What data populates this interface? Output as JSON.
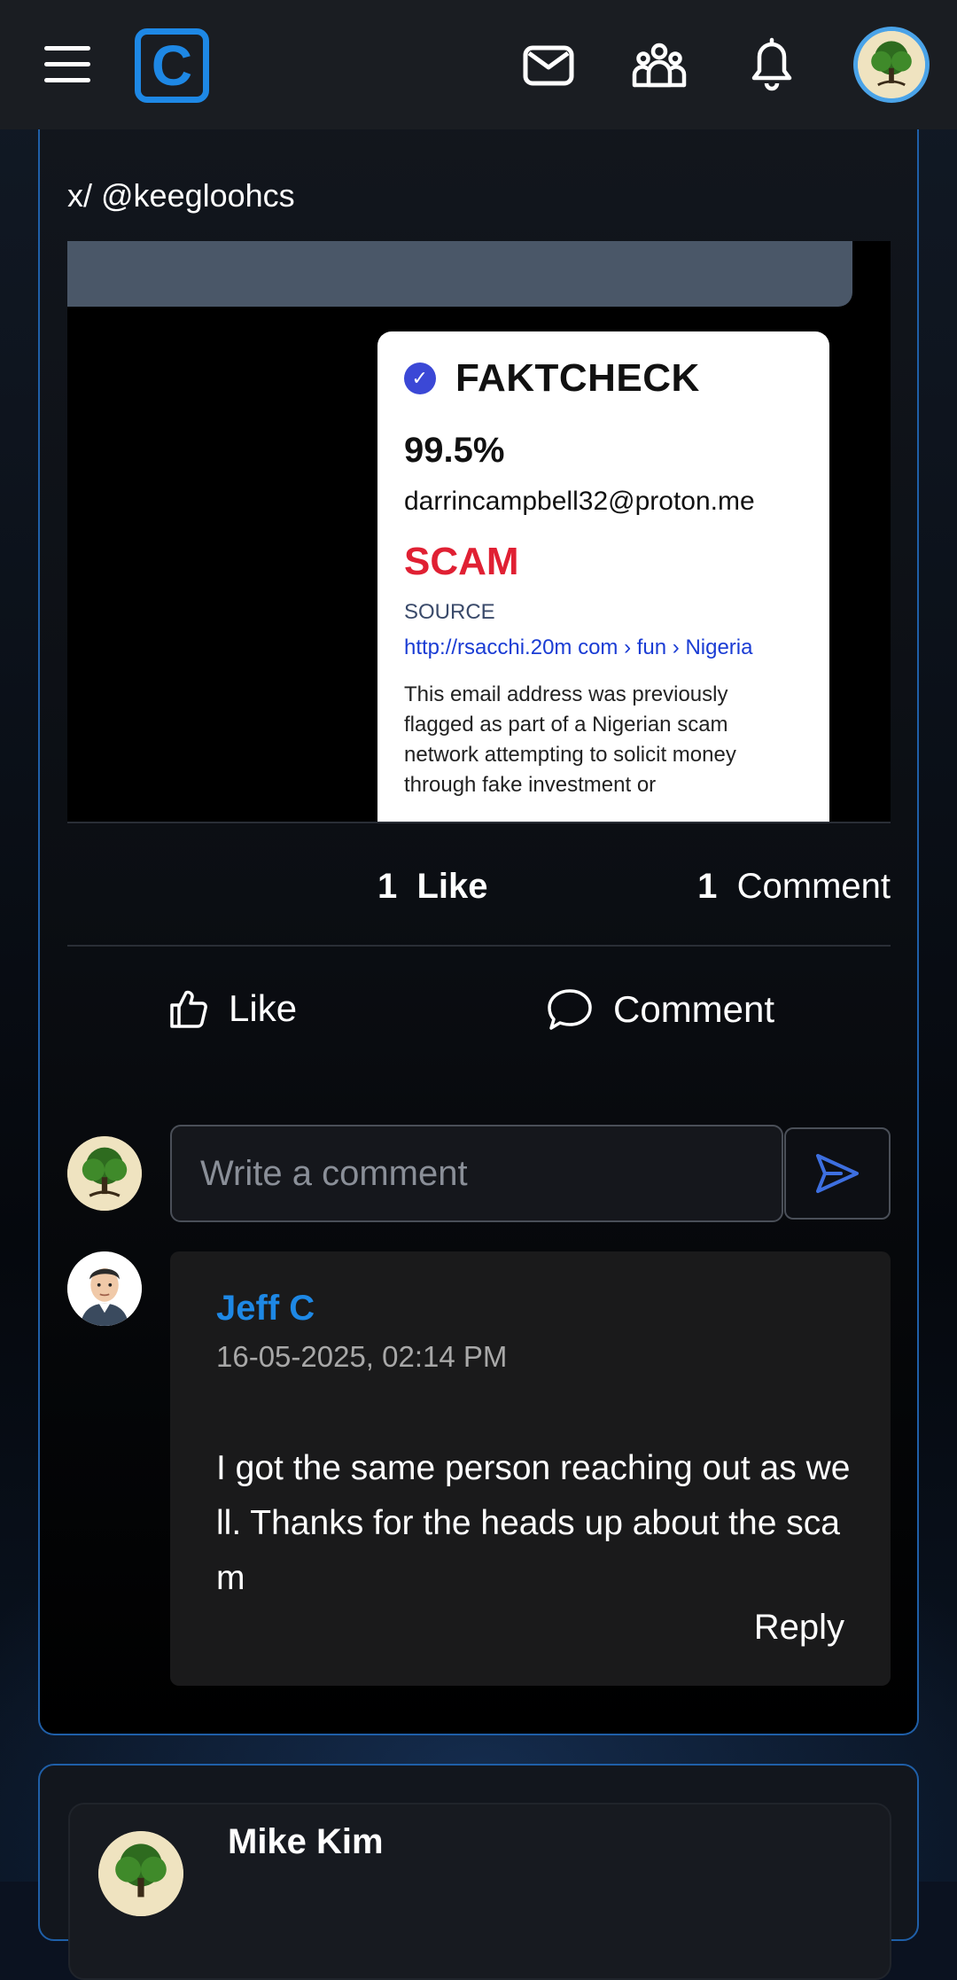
{
  "header": {
    "menu_icon": "hamburger-menu-icon",
    "logo_letter": "C",
    "icons": [
      "mail-icon",
      "groups-icon",
      "bell-icon"
    ],
    "accent_color": "#1e88e5"
  },
  "post": {
    "handle": "x/ @keegloohcs",
    "image": {
      "title": "FAKTCHECK",
      "percent": "99.5%",
      "email": "darrincampbell32@proton.me",
      "verdict": "SCAM",
      "source_label": "SOURCE",
      "source_url": "http://rsacchi.20m com › fun › Nigeria",
      "description": "This email address was previously flagged as part of a Nigerian scam network attempting to solicit money through fake investment or"
    },
    "stats": {
      "likes_count": "1",
      "likes_label": "Like",
      "comments_count": "1",
      "comments_label": "Comment"
    },
    "actions": {
      "like_label": "Like",
      "comment_label": "Comment"
    },
    "comment_input": {
      "placeholder": "Write a comment"
    },
    "comments": [
      {
        "author": "Jeff C",
        "timestamp": "16-05-2025, 02:14 PM",
        "text": "I got the same person reaching out as well. Thanks for the heads up about the scam",
        "reply_label": "Reply"
      }
    ]
  },
  "next_post": {
    "author": "Mike Kim"
  }
}
